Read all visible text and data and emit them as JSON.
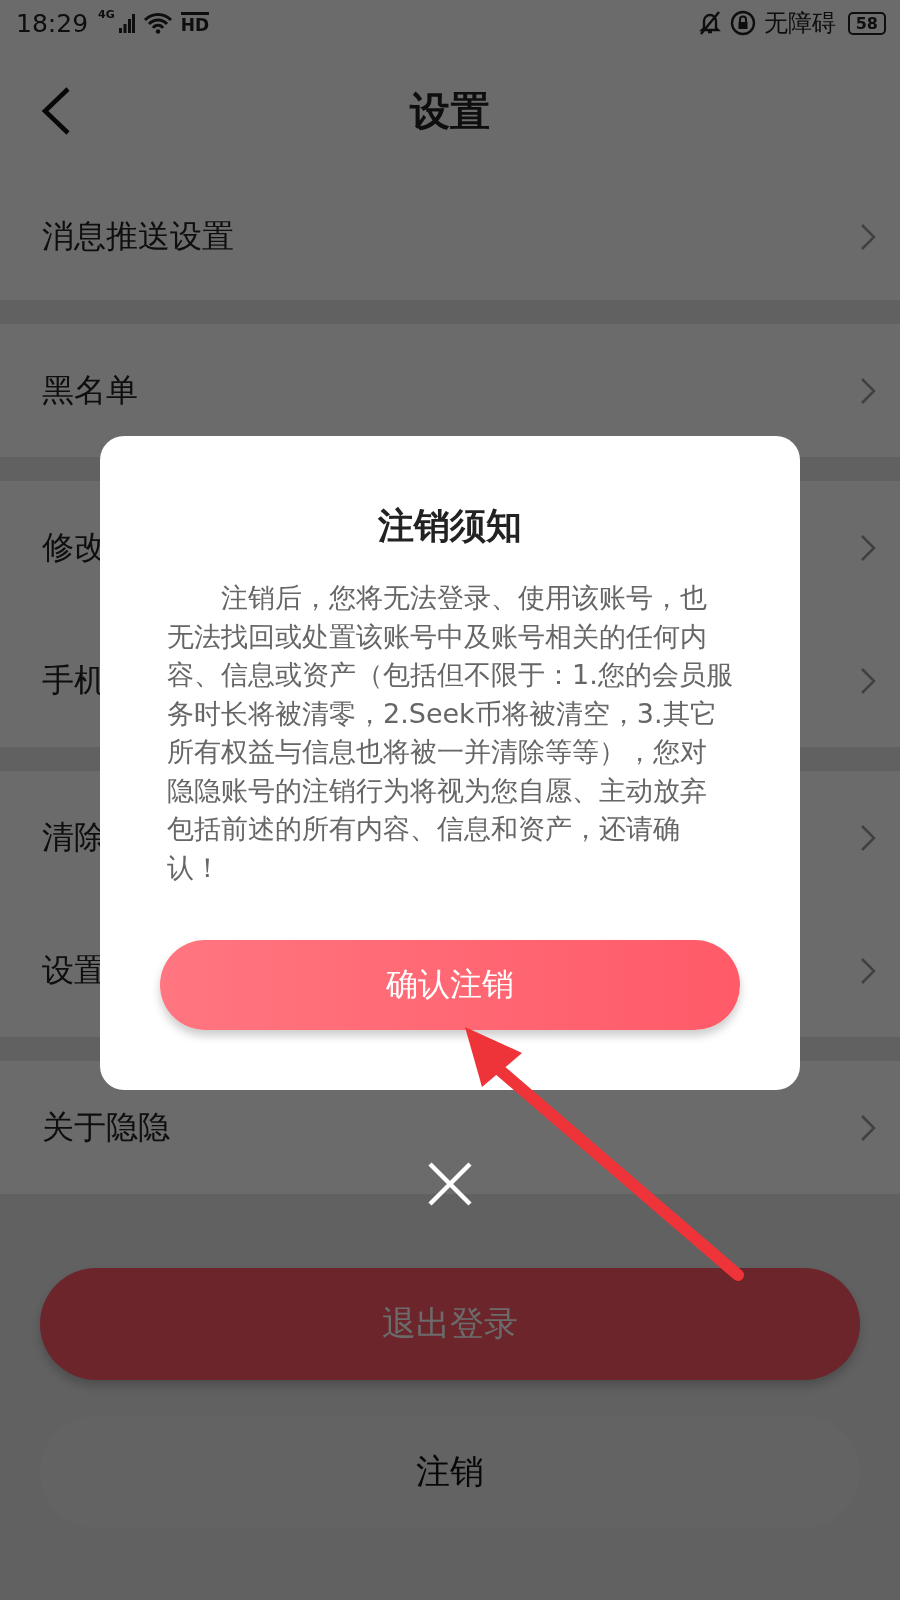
{
  "status_bar": {
    "time": "18:29",
    "network": "4G",
    "hd": "HD",
    "accessibility": "无障碍",
    "battery": "58"
  },
  "header": {
    "title": "设置"
  },
  "groups": [
    [
      {
        "label": "消息推送设置"
      }
    ],
    [
      {
        "label": "黑名单"
      }
    ],
    [
      {
        "label": "修改"
      },
      {
        "label": "手机"
      }
    ],
    [
      {
        "label": "清除"
      },
      {
        "label": "设置"
      }
    ],
    [
      {
        "label": "关于隐隐"
      }
    ]
  ],
  "buttons": [
    {
      "kind": "primary",
      "label": "退出登录"
    },
    {
      "kind": "secondary",
      "label": "注销"
    }
  ],
  "dialog": {
    "title": "注销须知",
    "body": "注销后，您将无法登录、使用该账号，也无法找回或处置该账号中及账号相关的任何内容、信息或资产（包括但不限于：1.您的会员服务时长将被清零，2.Seek币将被清空，3.其它所有权益与信息也将被一并清除等等），您对隐隐账号的注销行为将视为您自愿、主动放弃包括前述的所有内容、信息和资产，还请确认！",
    "confirm": "确认注销"
  }
}
